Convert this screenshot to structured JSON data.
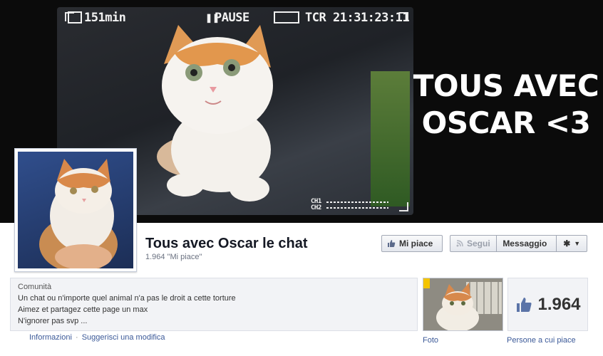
{
  "cover": {
    "recording_time": "151min",
    "pause_label": "PAUSE",
    "tcr_label": "TCR",
    "timecode": "21:31:23:11",
    "channels": [
      "CH1",
      "CH2"
    ],
    "headline": [
      "TOUS AVEC",
      "OSCAR <3"
    ]
  },
  "page": {
    "title": "Tous avec Oscar le chat",
    "likes_text": "1.964 \"Mi piace\""
  },
  "actions": {
    "like_label": "Mi piace",
    "follow_label": "Segui",
    "message_label": "Messaggio",
    "settings_icon": "gear-icon"
  },
  "about": {
    "category": "Comunità",
    "lines": [
      "Un chat ou n'importe quel animal n'a pas le droit a cette torture",
      "Aimez et partagez cette page un max",
      "N'ignorer pas svp ..."
    ],
    "links": {
      "info": "Informazioni",
      "separator": "·",
      "suggest": "Suggerisci una modifica"
    }
  },
  "apps": {
    "photos_label": "Foto",
    "likes_number": "1.964",
    "likes_label": "Persone a cui piace"
  },
  "colors": {
    "link": "#3b5998",
    "title": "#141823",
    "panel": "#f2f3f6"
  }
}
